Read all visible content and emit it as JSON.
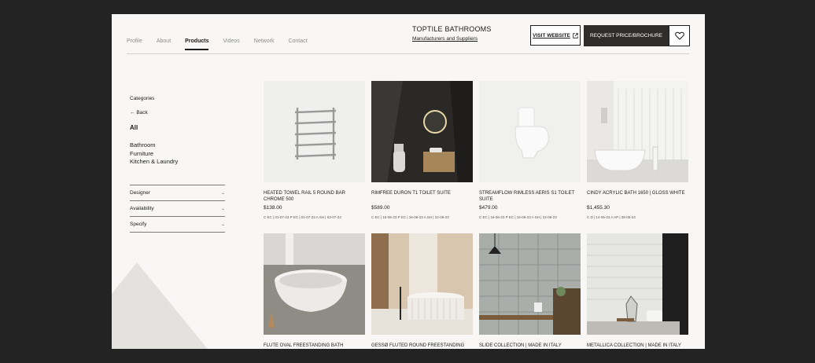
{
  "nav": {
    "tabs": [
      "Profile",
      "About",
      "Products",
      "Videos",
      "Network",
      "Contact"
    ],
    "active": "Products"
  },
  "brand": {
    "name": "TOPTILE BATHROOMS",
    "subtitle": "Manufacturers and Suppliers"
  },
  "actions": {
    "visit_website": "VISIT WEBSITE",
    "request": "REQUEST PRICE/BROCHURE"
  },
  "sidebar": {
    "categories_label": "Categories",
    "back_label": "Back",
    "all_label": "All",
    "categories": [
      "Bathroom",
      "Furniture",
      "Kitchen & Laundry"
    ],
    "filters": [
      "Designer",
      "Availability",
      "Specify"
    ]
  },
  "products": [
    {
      "title": "HEATED TOWEL RAIL 5 ROUND BAR CHROME 500",
      "price": "$138.00",
      "meta": "C EC | 01-07-23  P EC | 01-07-23  A SH | 03-07-23"
    },
    {
      "title": "RIMFREE DURON T1 TOILET SUITE",
      "price": "$589.00",
      "meta": "C EC | 16-06-23  P EC | 16-06-23  A SH | 22-06-23"
    },
    {
      "title": "STREAMFLOW RIMLESS AERIS S1 TOILET SUITE",
      "price": "$479.00",
      "meta": "C EC | 16-06-23  P EC | 16-06-23  A SH | 22-06-23"
    },
    {
      "title": "CINDY ACRYLIC BATH 1650 | GLOSS WHITE",
      "price": "$1,455.30",
      "meta": "C D | 14-05-23  A AP | 28-05-23"
    },
    {
      "title": "FLUTE OVAL FREESTANDING BATH",
      "price": "",
      "meta": ""
    },
    {
      "title": "GESSØ FLUTED ROUND FREESTANDING BATH",
      "price": "",
      "meta": ""
    },
    {
      "title": "SLIDE COLLECTION | MADE IN ITALY",
      "price": "",
      "meta": ""
    },
    {
      "title": "METALLICA COLLECTION | MADE IN ITALY",
      "price": "",
      "meta": ""
    }
  ]
}
